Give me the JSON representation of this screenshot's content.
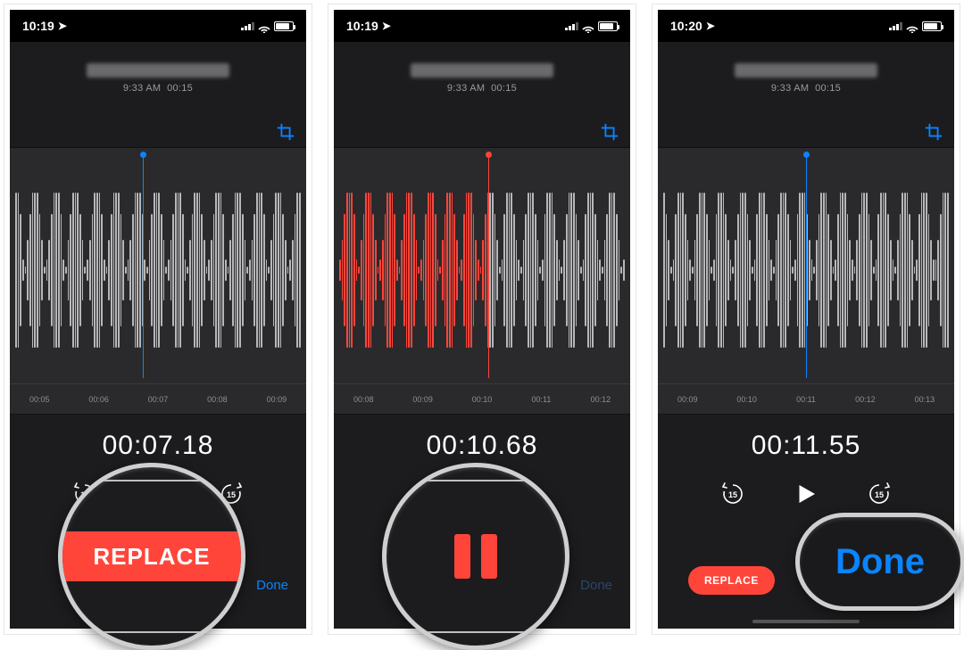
{
  "screens": [
    {
      "status_time": "10:19",
      "rec_time": "9:33 AM",
      "rec_duration": "00:15",
      "ticks": [
        "00:05",
        "00:06",
        "00:07",
        "00:08",
        "00:09"
      ],
      "bigtime": "00:07.18",
      "playhead_color": "blue",
      "playhead_left_pct": 45,
      "wave_left_red": false,
      "replace_label": "REPLACE",
      "done_label": "Done",
      "done_dim": false,
      "skip_num": "15",
      "callout": {
        "kind": "replace",
        "label": "REPLACE"
      }
    },
    {
      "status_time": "10:19",
      "rec_time": "9:33 AM",
      "rec_duration": "00:15",
      "ticks": [
        "00:08",
        "00:09",
        "00:10",
        "00:11",
        "00:12"
      ],
      "bigtime": "00:10.68",
      "playhead_color": "red",
      "playhead_left_pct": 52,
      "wave_left_red": true,
      "replace_label": "",
      "done_label": "Done",
      "done_dim": true,
      "skip_num": "15",
      "callout": {
        "kind": "pause"
      }
    },
    {
      "status_time": "10:20",
      "rec_time": "9:33 AM",
      "rec_duration": "00:15",
      "ticks": [
        "00:09",
        "00:10",
        "00:11",
        "00:12",
        "00:13"
      ],
      "bigtime": "00:11.55",
      "playhead_color": "blue",
      "playhead_left_pct": 50,
      "wave_left_red": false,
      "replace_label": "REPLACE",
      "done_label": "Done",
      "done_dim": false,
      "skip_num": "15",
      "callout": {
        "kind": "done",
        "label": "Done"
      }
    }
  ]
}
